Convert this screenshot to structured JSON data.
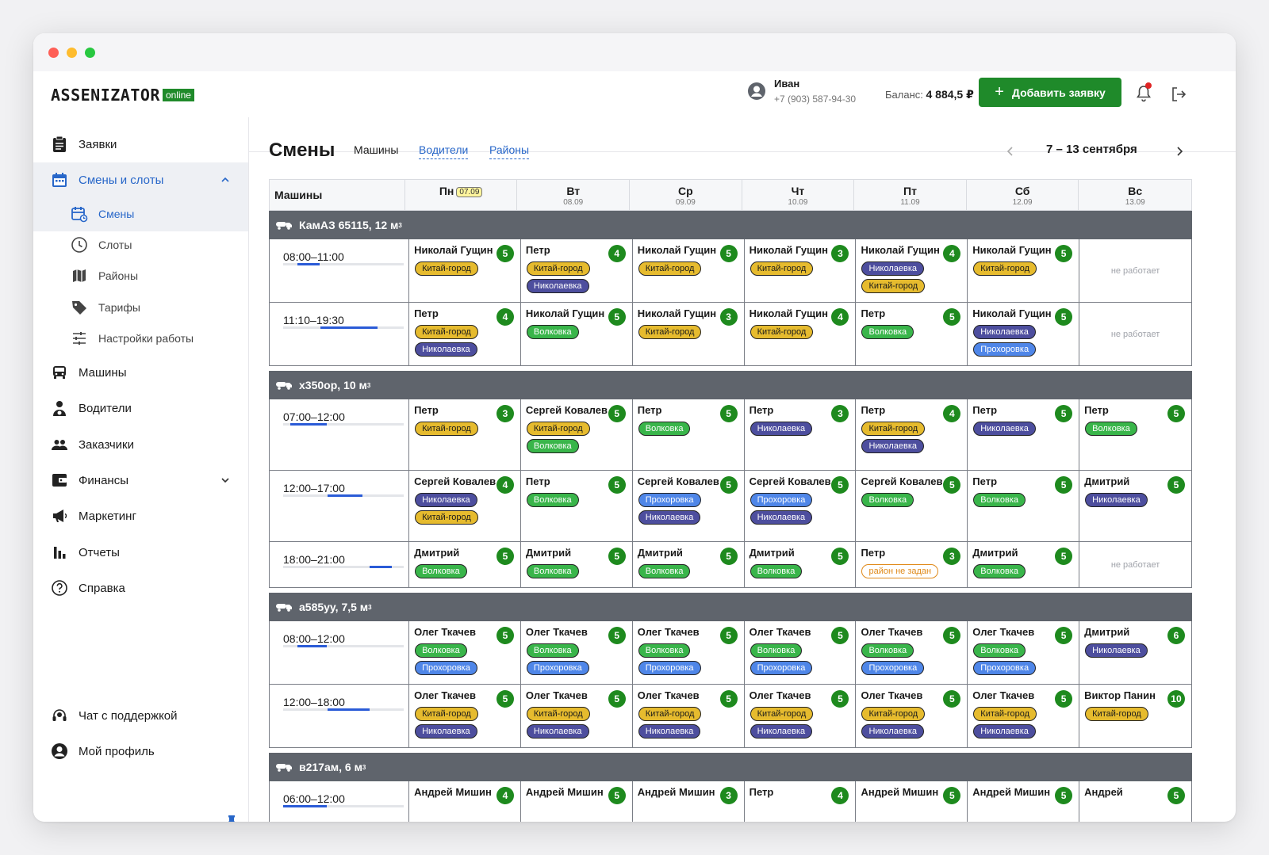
{
  "app": {
    "logo_text": "ASSENIZATOR",
    "logo_badge": "online"
  },
  "header": {
    "user_name": "Иван",
    "user_phone": "+7 (903) 587-94-30",
    "balance_label": "Баланс:",
    "balance_value": "4 884,5 ₽",
    "add_button": "Добавить заявку"
  },
  "sidebar": {
    "items": [
      {
        "label": "Заявки",
        "icon": "clipboard-icon"
      },
      {
        "label": "Смены и слоты",
        "icon": "calendar-icon"
      },
      {
        "label": "Смены",
        "icon": "calendar-refresh-icon"
      },
      {
        "label": "Слоты",
        "icon": "clock-icon"
      },
      {
        "label": "Районы",
        "icon": "map-icon"
      },
      {
        "label": "Тарифы",
        "icon": "tag-icon"
      },
      {
        "label": "Настройки работы",
        "icon": "sliders-icon"
      },
      {
        "label": "Машины",
        "icon": "truck-icon"
      },
      {
        "label": "Водители",
        "icon": "driver-icon"
      },
      {
        "label": "Заказчики",
        "icon": "people-icon"
      },
      {
        "label": "Финансы",
        "icon": "wallet-icon"
      },
      {
        "label": "Маркетинг",
        "icon": "megaphone-icon"
      },
      {
        "label": "Отчеты",
        "icon": "bar-chart-icon"
      },
      {
        "label": "Справка",
        "icon": "help-icon"
      }
    ],
    "bottom": [
      {
        "label": "Чат с поддержкой",
        "icon": "headset-icon"
      },
      {
        "label": "Мой профиль",
        "icon": "profile-icon"
      }
    ]
  },
  "page": {
    "title": "Смены",
    "tabs": [
      "Машины",
      "Водители",
      "Районы"
    ],
    "week": "7 – 13 сентября"
  },
  "grid": {
    "first_col": "Машины",
    "days": [
      {
        "name": "Пн",
        "date": "07.09",
        "today": true
      },
      {
        "name": "Вт",
        "date": "08.09"
      },
      {
        "name": "Ср",
        "date": "09.09"
      },
      {
        "name": "Чт",
        "date": "10.09"
      },
      {
        "name": "Пт",
        "date": "11.09"
      },
      {
        "name": "Сб",
        "date": "12.09"
      },
      {
        "name": "Вс",
        "date": "13.09"
      }
    ],
    "off_text": "не работает",
    "vehicles": [
      {
        "name": "КамАЗ 65115, 12 м",
        "unit_sup": "3",
        "rows": [
          {
            "time": "08:00–11:00",
            "bar_start": 0.12,
            "bar_end": 0.3,
            "cells": [
              {
                "driver": "Николай Гущин",
                "score": "5",
                "tags": [
                  "Китай-город"
                ]
              },
              {
                "driver": "Петр",
                "score": "4",
                "tags": [
                  "Китай-город",
                  "Николаевка"
                ]
              },
              {
                "driver": "Николай Гущин",
                "score": "5",
                "tags": [
                  "Китай-город"
                ]
              },
              {
                "driver": "Николай Гущин",
                "score": "3",
                "tags": [
                  "Китай-город"
                ]
              },
              {
                "driver": "Николай Гущин",
                "score": "4",
                "tags": [
                  "Николаевка",
                  "Китай-город"
                ]
              },
              {
                "driver": "Николай Гущин",
                "score": "5",
                "tags": [
                  "Китай-город"
                ]
              },
              {
                "off": true
              }
            ]
          },
          {
            "time": "11:10–19:30",
            "bar_start": 0.31,
            "bar_end": 0.78,
            "cells": [
              {
                "driver": "Петр",
                "score": "4",
                "tags": [
                  "Китай-город",
                  "Николаевка"
                ]
              },
              {
                "driver": "Николай Гущин",
                "score": "5",
                "tags": [
                  "Волковка"
                ]
              },
              {
                "driver": "Николай Гущин",
                "score": "3",
                "tags": [
                  "Китай-город"
                ]
              },
              {
                "driver": "Николай Гущин",
                "score": "4",
                "tags": [
                  "Китай-город"
                ]
              },
              {
                "driver": "Петр",
                "score": "5",
                "tags": [
                  "Волковка"
                ]
              },
              {
                "driver": "Николай Гущин",
                "score": "5",
                "tags": [
                  "Николаевка",
                  "Прохоровка"
                ]
              },
              {
                "off": true
              }
            ]
          }
        ]
      },
      {
        "name": "х350ор, 10 м",
        "unit_sup": "3",
        "rows": [
          {
            "time": "07:00–12:00",
            "bar_start": 0.06,
            "bar_end": 0.36,
            "cells": [
              {
                "driver": "Петр",
                "score": "3",
                "tags": [
                  "Китай-город"
                ]
              },
              {
                "driver": "Сергей Ковалев",
                "score": "5",
                "tags": [
                  "Китай-город",
                  "Волковка"
                ]
              },
              {
                "driver": "Петр",
                "score": "5",
                "tags": [
                  "Волковка"
                ]
              },
              {
                "driver": "Петр",
                "score": "3",
                "tags": [
                  "Николаевка"
                ]
              },
              {
                "driver": "Петр",
                "score": "4",
                "tags": [
                  "Китай-город",
                  "Николаевка"
                ]
              },
              {
                "driver": "Петр",
                "score": "5",
                "tags": [
                  "Николаевка"
                ]
              },
              {
                "driver": "Петр",
                "score": "5",
                "tags": [
                  "Волковка"
                ]
              }
            ]
          },
          {
            "time": "12:00–17:00",
            "bar_start": 0.37,
            "bar_end": 0.66,
            "cells": [
              {
                "driver": "Сергей Ковалев",
                "score": "4",
                "tags": [
                  "Николаевка",
                  "Китай-город"
                ]
              },
              {
                "driver": "Петр",
                "score": "5",
                "tags": [
                  "Волковка"
                ]
              },
              {
                "driver": "Сергей Ковалев",
                "score": "5",
                "tags": [
                  "Прохоровка",
                  "Николаевка"
                ]
              },
              {
                "driver": "Сергей Ковалев",
                "score": "5",
                "tags": [
                  "Прохоровка",
                  "Николаевка"
                ]
              },
              {
                "driver": "Сергей Ковалев",
                "score": "5",
                "tags": [
                  "Волковка"
                ]
              },
              {
                "driver": "Петр",
                "score": "5",
                "tags": [
                  "Волковка"
                ]
              },
              {
                "driver": "Дмитрий",
                "score": "5",
                "tags": [
                  "Николаевка"
                ]
              }
            ]
          },
          {
            "time": "18:00–21:00",
            "bar_start": 0.72,
            "bar_end": 0.9,
            "cells": [
              {
                "driver": "Дмитрий",
                "score": "5",
                "tags": [
                  "Волковка"
                ]
              },
              {
                "driver": "Дмитрий",
                "score": "5",
                "tags": [
                  "Волковка"
                ]
              },
              {
                "driver": "Дмитрий",
                "score": "5",
                "tags": [
                  "Волковка"
                ]
              },
              {
                "driver": "Дмитрий",
                "score": "5",
                "tags": [
                  "Волковка"
                ]
              },
              {
                "driver": "Петр",
                "score": "3",
                "tags": [
                  "район не задан"
                ]
              },
              {
                "driver": "Дмитрий",
                "score": "5",
                "tags": [
                  "Волковка"
                ]
              },
              {
                "off": true
              }
            ]
          }
        ]
      },
      {
        "name": "а585уу, 7,5 м",
        "unit_sup": "3",
        "rows": [
          {
            "time": "08:00–12:00",
            "bar_start": 0.12,
            "bar_end": 0.36,
            "cells": [
              {
                "driver": "Олег Ткачев",
                "score": "5",
                "tags": [
                  "Волковка",
                  "Прохоровка"
                ]
              },
              {
                "driver": "Олег Ткачев",
                "score": "5",
                "tags": [
                  "Волковка",
                  "Прохоровка"
                ]
              },
              {
                "driver": "Олег Ткачев",
                "score": "5",
                "tags": [
                  "Волковка",
                  "Прохоровка"
                ]
              },
              {
                "driver": "Олег Ткачев",
                "score": "5",
                "tags": [
                  "Волковка",
                  "Прохоровка"
                ]
              },
              {
                "driver": "Олег Ткачев",
                "score": "5",
                "tags": [
                  "Волковка",
                  "Прохоровка"
                ]
              },
              {
                "driver": "Олег Ткачев",
                "score": "5",
                "tags": [
                  "Волковка",
                  "Прохоровка"
                ]
              },
              {
                "driver": "Дмитрий",
                "score": "6",
                "tags": [
                  "Николаевка"
                ]
              }
            ]
          },
          {
            "time": "12:00–18:00",
            "bar_start": 0.37,
            "bar_end": 0.72,
            "cells": [
              {
                "driver": "Олег Ткачев",
                "score": "5",
                "tags": [
                  "Китай-город",
                  "Николаевка"
                ]
              },
              {
                "driver": "Олег Ткачев",
                "score": "5",
                "tags": [
                  "Китай-город",
                  "Николаевка"
                ]
              },
              {
                "driver": "Олег Ткачев",
                "score": "5",
                "tags": [
                  "Китай-город",
                  "Николаевка"
                ]
              },
              {
                "driver": "Олег Ткачев",
                "score": "5",
                "tags": [
                  "Китай-город",
                  "Николаевка"
                ]
              },
              {
                "driver": "Олег Ткачев",
                "score": "5",
                "tags": [
                  "Китай-город",
                  "Николаевка"
                ]
              },
              {
                "driver": "Олег Ткачев",
                "score": "5",
                "tags": [
                  "Китай-город",
                  "Николаевка"
                ]
              },
              {
                "driver": "Виктор Панин",
                "score": "10",
                "tags": [
                  "Китай-город"
                ]
              }
            ]
          }
        ]
      },
      {
        "name": "в217ам, 6 м",
        "unit_sup": "3",
        "rows": [
          {
            "time": "06:00–12:00",
            "bar_start": 0.0,
            "bar_end": 0.36,
            "cells": [
              {
                "driver": "Андрей Мишин",
                "score": "4",
                "tags": []
              },
              {
                "driver": "Андрей Мишин",
                "score": "5",
                "tags": []
              },
              {
                "driver": "Андрей Мишин",
                "score": "3",
                "tags": []
              },
              {
                "driver": "Петр",
                "score": "4",
                "tags": []
              },
              {
                "driver": "Андрей Мишин",
                "score": "5",
                "tags": []
              },
              {
                "driver": "Андрей Мишин",
                "score": "5",
                "tags": []
              },
              {
                "driver": "Андрей",
                "score": "5",
                "tags": []
              }
            ]
          }
        ]
      }
    ]
  },
  "colors": {
    "brand_green": "#1f8a2a",
    "accent_blue": "#2867c9",
    "vehicle_bar": "#5f646c"
  }
}
